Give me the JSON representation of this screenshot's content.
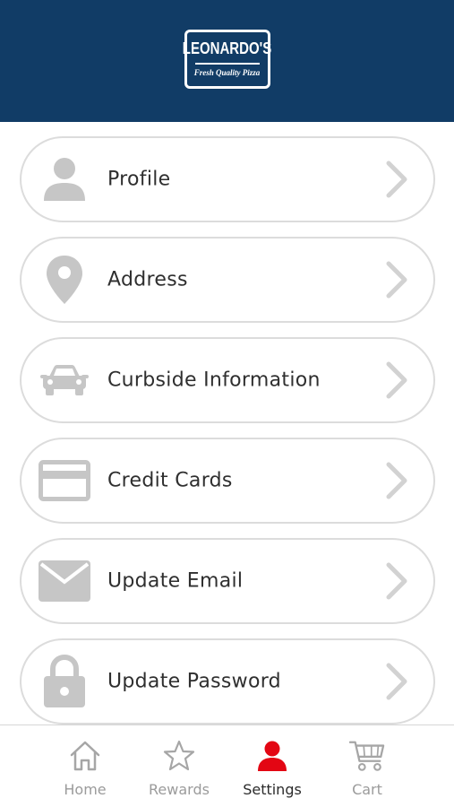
{
  "header": {
    "brand_name": "LEONARDO'S",
    "brand_tagline": "Fresh Quality Pizza",
    "background_color": "#113c66"
  },
  "menu": {
    "items": [
      {
        "label": "Profile",
        "icon": "person-icon"
      },
      {
        "label": "Address",
        "icon": "map-pin-icon"
      },
      {
        "label": "Curbside Information",
        "icon": "car-icon"
      },
      {
        "label": "Credit Cards",
        "icon": "credit-card-icon"
      },
      {
        "label": "Update Email",
        "icon": "envelope-icon"
      },
      {
        "label": "Update Password",
        "icon": "lock-icon"
      }
    ],
    "icon_color": "#c6c6c6",
    "chevron_icon": "chevron-right-icon"
  },
  "tabbar": {
    "tabs": [
      {
        "label": "Home",
        "icon": "home-icon",
        "active": false
      },
      {
        "label": "Rewards",
        "icon": "star-icon",
        "active": false
      },
      {
        "label": "Settings",
        "icon": "person-icon",
        "active": true
      },
      {
        "label": "Cart",
        "icon": "cart-icon",
        "active": false
      }
    ],
    "active_color": "#e30613",
    "inactive_color": "#9b9b9b"
  }
}
